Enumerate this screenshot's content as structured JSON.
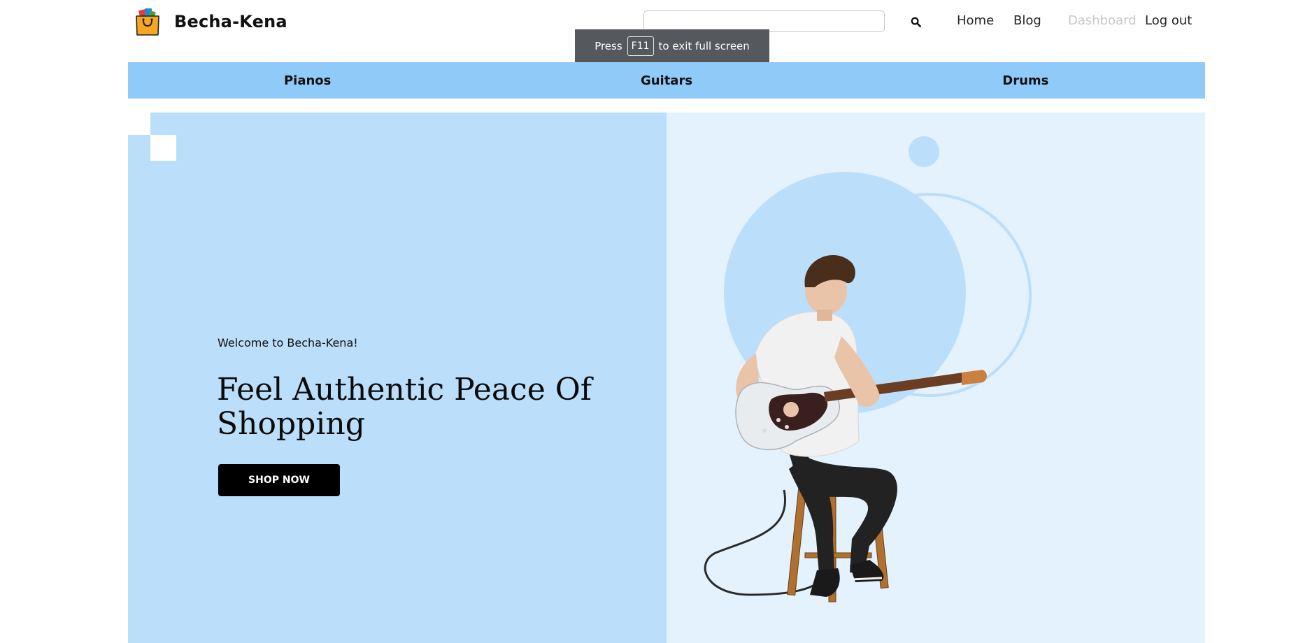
{
  "header": {
    "brand_name": "Becha-Kena",
    "search_placeholder": "",
    "search_value": "",
    "nav": [
      {
        "label": "Home"
      },
      {
        "label": "Blog"
      },
      {
        "label": "Dashboard"
      },
      {
        "label": "Log out"
      }
    ]
  },
  "fullscreen_notice": {
    "prefix": "Press",
    "key": "F11",
    "suffix": "to exit full screen"
  },
  "categories": [
    {
      "label": "Pianos"
    },
    {
      "label": "Guitars"
    },
    {
      "label": "Drums"
    }
  ],
  "hero": {
    "welcome": "Welcome to Becha-Kena!",
    "title": "Feel Authentic Peace Of Shopping",
    "cta_label": "SHOP NOW"
  },
  "colors": {
    "category_bar": "#90caf9",
    "hero_left": "#bbdefa",
    "hero_right": "#e3f2fd",
    "cta": "#000000",
    "dashboard_link": "#c7c7c7"
  }
}
